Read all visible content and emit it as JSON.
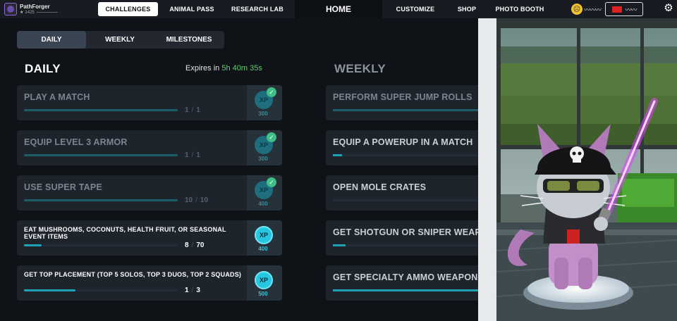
{
  "profile": {
    "name": "PathForger",
    "level": "1425"
  },
  "nav": {
    "challenges": "CHALLENGES",
    "animal_pass": "ANIMAL PASS",
    "research_lab": "RESEARCH LAB",
    "home": "HOME",
    "customize": "CUSTOMIZE",
    "shop": "SHOP",
    "photo_booth": "PHOTO BOOTH"
  },
  "subtabs": {
    "daily": "DAILY",
    "weekly": "WEEKLY",
    "milestones": "MILESTONES"
  },
  "daily": {
    "title": "DAILY",
    "expires_label": "Expires in",
    "expires_time": "5h 40m 35s",
    "challenges": [
      {
        "name": "PLAY A MATCH",
        "progress": "1",
        "total": "1",
        "xp_label": "XP",
        "xp": "300",
        "completed": true,
        "fraction": 1.0
      },
      {
        "name": "EQUIP LEVEL 3 ARMOR",
        "progress": "1",
        "total": "1",
        "xp_label": "XP",
        "xp": "300",
        "completed": true,
        "fraction": 1.0
      },
      {
        "name": "USE SUPER TAPE",
        "progress": "10",
        "total": "10",
        "xp_label": "XP",
        "xp": "400",
        "completed": true,
        "fraction": 1.0
      },
      {
        "name": "EAT MUSHROOMS, COCONUTS, HEALTH FRUIT, OR SEASONAL EVENT ITEMS",
        "progress": "8",
        "total": "70",
        "xp_label": "XP",
        "xp": "400",
        "completed": false,
        "fraction": 0.114
      },
      {
        "name": "GET TOP PLACEMENT (TOP 5 SOLOS, TOP 3 DUOS, TOP 2 SQUADS)",
        "progress": "1",
        "total": "3",
        "xp_label": "XP",
        "xp": "500",
        "completed": false,
        "fraction": 0.333
      }
    ]
  },
  "weekly": {
    "title": "WEEKLY",
    "challenges": [
      {
        "name": "PERFORM SUPER JUMP ROLLS",
        "completed": true,
        "fraction": 1.0
      },
      {
        "name": "EQUIP A POWERUP IN A MATCH",
        "completed": false,
        "fraction": 0.06
      },
      {
        "name": "OPEN MOLE CRATES",
        "completed": false,
        "fraction": 0.0
      },
      {
        "name": "GET SHOTGUN OR SNIPER WEAPO",
        "completed": false,
        "fraction": 0.08
      },
      {
        "name": "GET SPECIALTY AMMO WEAPON",
        "completed": false,
        "fraction": 1.0
      }
    ]
  },
  "icons": {
    "settings": "gear-icon",
    "currency": "ticket-icon",
    "emote": "smiley-icon",
    "check": "check-icon"
  },
  "colors": {
    "accent": "#25c7e0",
    "timer": "#59d36a",
    "check": "#3fbf86",
    "lightsaber": "#e040ff"
  }
}
